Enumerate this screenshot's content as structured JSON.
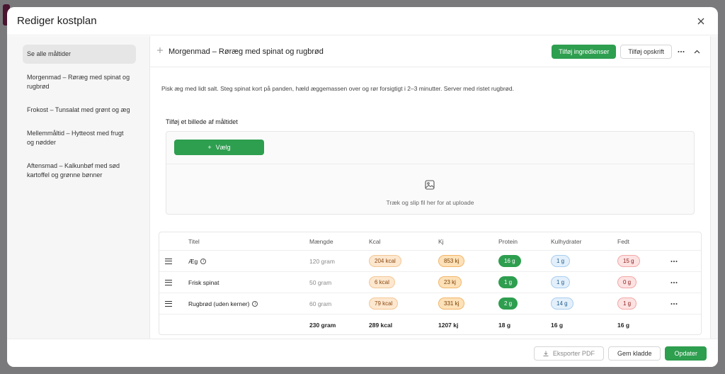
{
  "modal": {
    "title": "Rediger kostplan"
  },
  "sidebar": {
    "items": [
      {
        "label": "Se alle måltider"
      },
      {
        "label": "Morgenmad – Røræg med spinat og rugbrød"
      },
      {
        "label": "Frokost – Tunsalat med grønt og æg"
      },
      {
        "label": "Mellemmåltid – Hytteost med frugt og nødder"
      },
      {
        "label": "Aftensmad – Kalkunbøf med sød kartoffel og grønne bønner"
      }
    ]
  },
  "meal": {
    "title": "Morgenmad – Røræg med spinat og rugbrød",
    "add_ingredients_label": "Tilføj ingredienser",
    "add_recipe_label": "Tilføj opskrift",
    "description": "Pisk æg med lidt salt. Steg spinat kort på panden, hæld æggemassen over og rør forsigtigt i 2–3 minutter. Server med ristet rugbrød."
  },
  "upload": {
    "label": "Tilføj et billede af måltidet",
    "choose_label": "Vælg",
    "drop_text": "Træk og slip fil her for at uploade"
  },
  "table": {
    "headers": {
      "title": "Titel",
      "amount": "Mængde",
      "kcal": "Kcal",
      "kj": "Kj",
      "protein": "Protein",
      "carbs": "Kulhydrater",
      "fat": "Fedt"
    },
    "rows": [
      {
        "title": "Æg",
        "amount": "120 gram",
        "kcal": "204 kcal",
        "kj": "853 kj",
        "protein": "16 g",
        "carbs": "1 g",
        "fat": "15 g"
      },
      {
        "title": "Frisk spinat",
        "amount": "50 gram",
        "kcal": "6 kcal",
        "kj": "23 kj",
        "protein": "1 g",
        "carbs": "1 g",
        "fat": "0 g"
      },
      {
        "title": "Rugbrød (uden kerner)",
        "amount": "60 gram",
        "kcal": "79 kcal",
        "kj": "331 kj",
        "protein": "2 g",
        "carbs": "14 g",
        "fat": "1 g"
      }
    ],
    "totals": {
      "amount": "230 gram",
      "kcal": "289 kcal",
      "kj": "1207 kj",
      "protein": "18 g",
      "carbs": "16 g",
      "fat": "16 g"
    }
  },
  "footer": {
    "export_label": "Eksporter PDF",
    "draft_label": "Gem kladde",
    "update_label": "Opdater"
  },
  "colors": {
    "accent": "#2e9e4f"
  }
}
